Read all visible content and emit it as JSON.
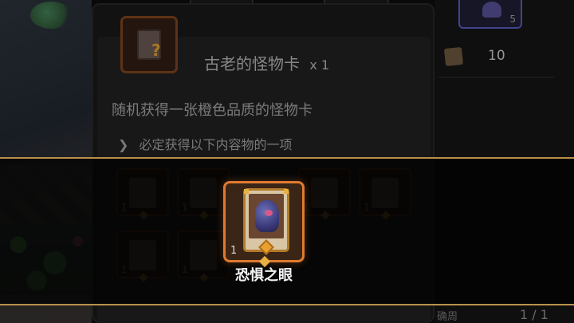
{
  "item": {
    "title": "古老的怪物卡",
    "quantity": "x 1",
    "description": "随机获得一张橙色品质的怪物卡",
    "guarantee_text": "必定获得以下内容物的一项",
    "icon": "mystery-card-icon",
    "icon_glyph": "?"
  },
  "rewards": [
    {
      "count": "1",
      "icon": "monster-card-icon"
    },
    {
      "count": "1",
      "icon": "monster-card-icon"
    },
    {
      "count": "1",
      "icon": "monster-card-icon"
    },
    {
      "count": "1",
      "icon": "monster-card-icon"
    },
    {
      "count": "1",
      "icon": "monster-card-icon"
    },
    {
      "count": "1",
      "icon": "monster-card-icon"
    },
    {
      "count": "1",
      "icon": "monster-card-icon"
    }
  ],
  "featured": {
    "name": "恐惧之眼",
    "count": "1",
    "icon": "monster-card-icon"
  },
  "top_bar": {
    "resource_count": "5",
    "scroll_value": "10",
    "top_slot_count": "0"
  },
  "footer": {
    "label": "确周",
    "page": "1 / 1"
  },
  "colors": {
    "accent_orange": "#e07a30",
    "band_gold": "#b8914a",
    "panel_bg": "#151515"
  }
}
